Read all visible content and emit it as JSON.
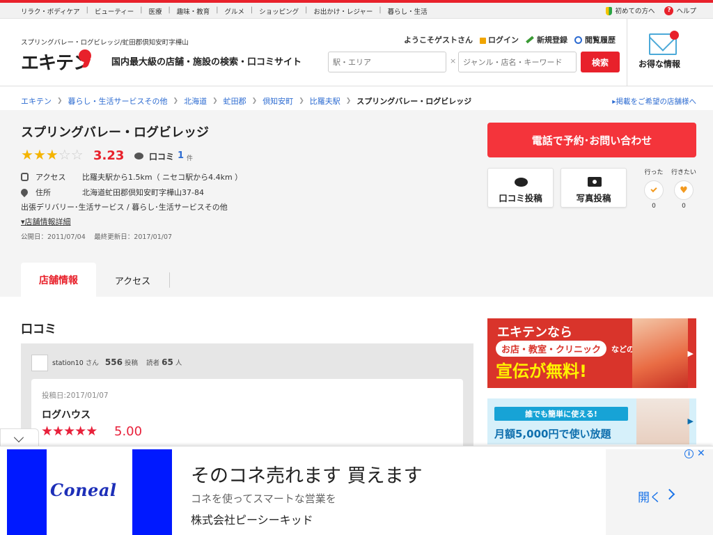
{
  "categories": [
    "リラク・ボディケア",
    "ビューティー",
    "医療",
    "趣味・教育",
    "グルメ",
    "ショッピング",
    "お出かけ・レジャー",
    "暮らし・生活"
  ],
  "utility": {
    "beginner": "初めての方へ",
    "help": "ヘルプ"
  },
  "header": {
    "shop_address": "スプリングバレー・ログビレッジ/虻田郡倶知安町字樺山",
    "logo_text": "エキテン",
    "tagline": "国内最大級の店舗・施設の検索・口コミサイト",
    "welcome": "ようこそゲストさん",
    "login": "ログイン",
    "register": "新規登録",
    "history": "閲覧履歴",
    "area_placeholder": "駅・エリア",
    "genre_placeholder": "ジャンル・店名・キーワード",
    "clear_mark": "×",
    "search_label": "検索",
    "deal_label": "お得な情報"
  },
  "breadcrumb": {
    "items": [
      "エキテン",
      "暮らし・生活サービスその他",
      "北海道",
      "虻田郡",
      "倶知安町",
      "比羅夫駅"
    ],
    "current": "スプリングバレー・ログビレッジ",
    "ad_request": "掲載をご希望の店舗様へ"
  },
  "shop": {
    "name": "スプリングバレー・ログビレッジ",
    "rating": "3.23",
    "rating_value": 3.23,
    "review_label": "口コミ",
    "review_count": "1",
    "review_unit": "件",
    "access_label": "アクセス",
    "access_value": "比羅夫駅から1.5km（ ニセコ駅から4.4km ）",
    "address_label": "住所",
    "address_value": "北海道虻田郡倶知安町字樺山37-84",
    "genres": "出張デリバリー･生活サービス /  暮らし･生活サービスその他",
    "detail_link": "店舗情報詳細",
    "dates": "公開日：2011/07/04　 最終更新日：2017/01/07",
    "call_button": "電話で予約･お問い合わせ",
    "post_review": "口コミ投稿",
    "post_photo": "写真投稿",
    "went_label": "行った",
    "want_label": "行きたい",
    "went_count": "0",
    "want_count": "0"
  },
  "tabs": {
    "active": "店舗情報",
    "other": "アクセス"
  },
  "reviews": {
    "section_title": "口コミ",
    "user": "station10",
    "user_suffix": "さん",
    "posts": "556",
    "posts_unit": "投稿",
    "readers_label": "読者",
    "readers": "65",
    "readers_unit": "人",
    "post_date": "投稿日:2017/01/07",
    "title": "ログハウス",
    "score": "5.00"
  },
  "banners": {
    "b1_top": "エキテンなら",
    "b1_pill": "お店・教室・クリニック",
    "b1_sub": "などの",
    "b1_big": "宣伝が無料!",
    "b2_top": "誰でも簡単に使える!",
    "b2_main": "月額5,000円で使い放題"
  },
  "ad": {
    "brand": "Coneal",
    "headline": "そのコネ売れます 買えます",
    "sub": "コネを使ってスマートな営業を",
    "company": "株式会社ピーシーキッド",
    "open": "開く"
  },
  "colors": {
    "accent": "#e8212b",
    "link": "#2c6bd1",
    "star": "#f4b400"
  }
}
